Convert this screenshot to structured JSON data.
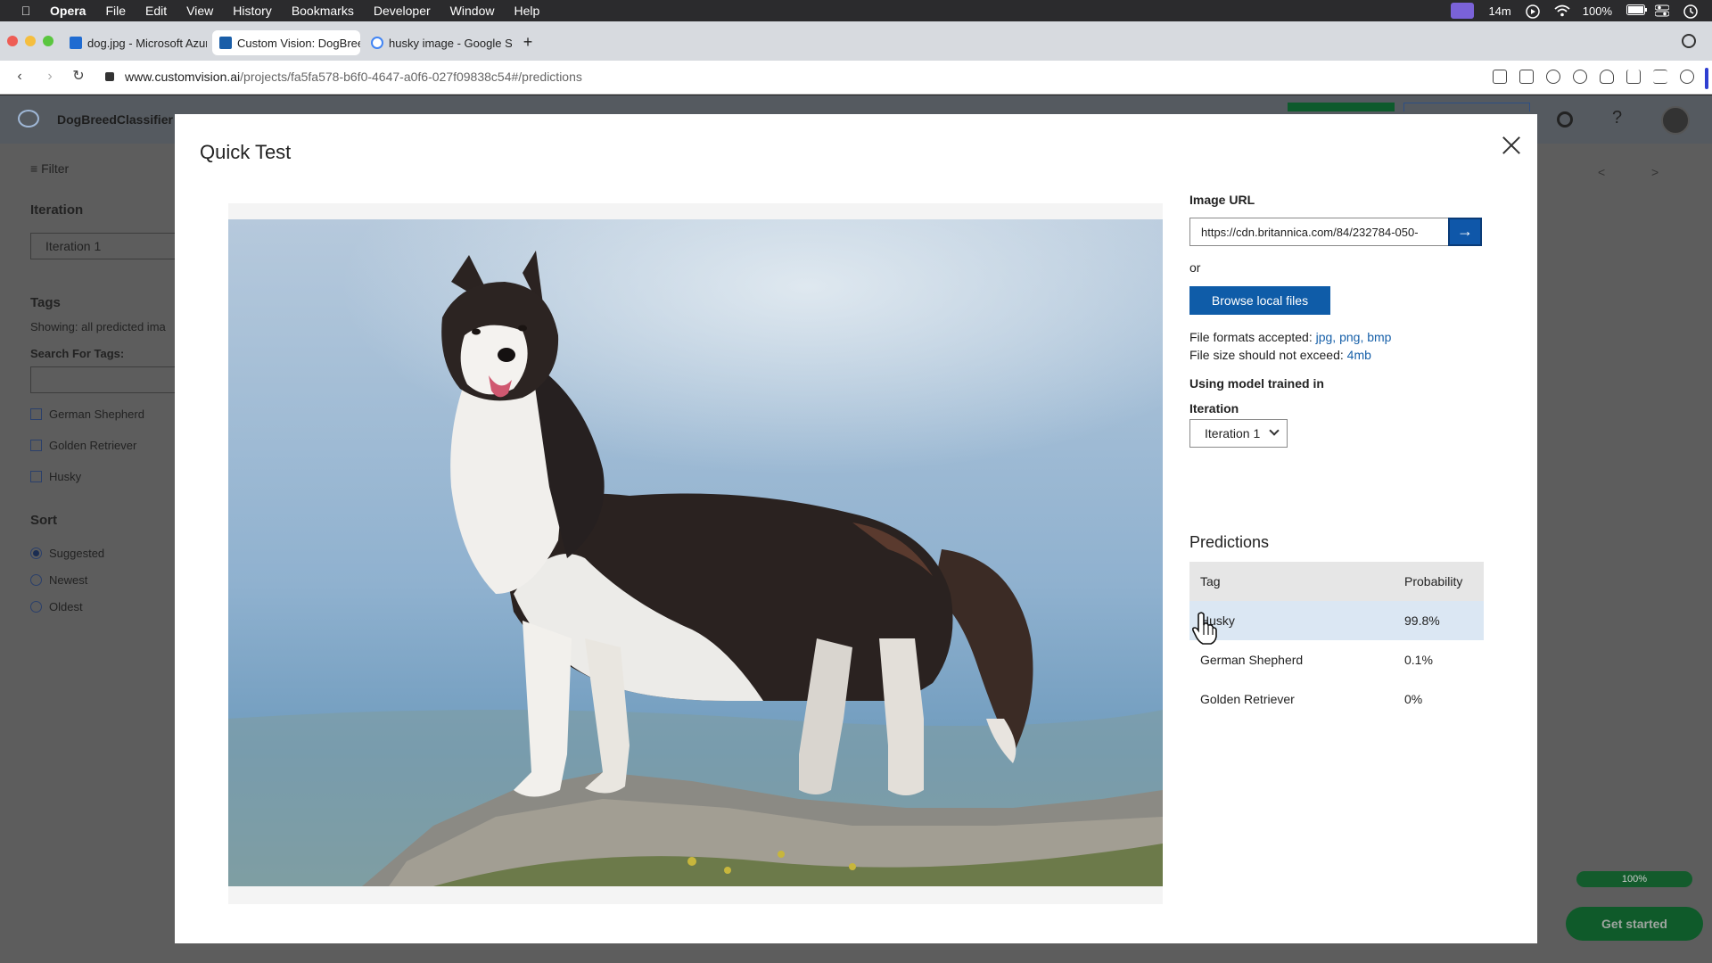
{
  "menubar": {
    "app": "Opera",
    "items": [
      "File",
      "Edit",
      "View",
      "History",
      "Bookmarks",
      "Developer",
      "Window",
      "Help"
    ],
    "time_left": "14m",
    "battery": "100%"
  },
  "tabs": [
    {
      "title": "dog.jpg - Microsoft Azure",
      "favicon_color": "#1f6bd1"
    },
    {
      "title": "Custom Vision: DogBreed",
      "favicon_color": "#1a5ea8"
    },
    {
      "title": "husky image - Google Search",
      "favicon_color": "#4285f4"
    }
  ],
  "address": {
    "host": "www.customvision.ai",
    "path": "/projects/fa5fa578-b6f0-4647-a0f6-027f09838c54#/predictions"
  },
  "app": {
    "project_name": "DogBreedClassifier",
    "sidebar": {
      "filter": "Filter",
      "iteration_heading": "Iteration",
      "iteration_value": "Iteration 1",
      "tags_heading": "Tags",
      "showing": "Showing: all predicted ima",
      "search_label": "Search For Tags:",
      "tags": [
        "German Shepherd",
        "Golden Retriever",
        "Husky"
      ],
      "sort_heading": "Sort",
      "sort_options": [
        "Suggested",
        "Newest",
        "Oldest"
      ],
      "sort_selected": "Suggested"
    },
    "pager_prev": "<",
    "pager_next": ">",
    "progress": "100%",
    "get_started": "Get started"
  },
  "modal": {
    "title": "Quick Test",
    "image_url_label": "Image URL",
    "image_url_value": "https://cdn.britannica.com/84/232784-050-",
    "or": "or",
    "browse_label": "Browse local files",
    "formats_prefix": "File formats accepted: ",
    "formats": "jpg, png, bmp",
    "size_prefix": "File size should not exceed: ",
    "size": "4mb",
    "model_label": "Using model trained in",
    "iteration_label": "Iteration",
    "iteration_value": "Iteration 1",
    "predictions_title": "Predictions",
    "columns": {
      "tag": "Tag",
      "probability": "Probability"
    },
    "predictions": [
      {
        "tag": "Husky",
        "probability": "99.8%"
      },
      {
        "tag": "German Shepherd",
        "probability": "0.1%"
      },
      {
        "tag": "Golden Retriever",
        "probability": "0%"
      }
    ]
  },
  "colors": {
    "accent_blue": "#0f5ca8",
    "highlight_row": "#dbe7f3",
    "header_row": "#e6e6e6"
  }
}
